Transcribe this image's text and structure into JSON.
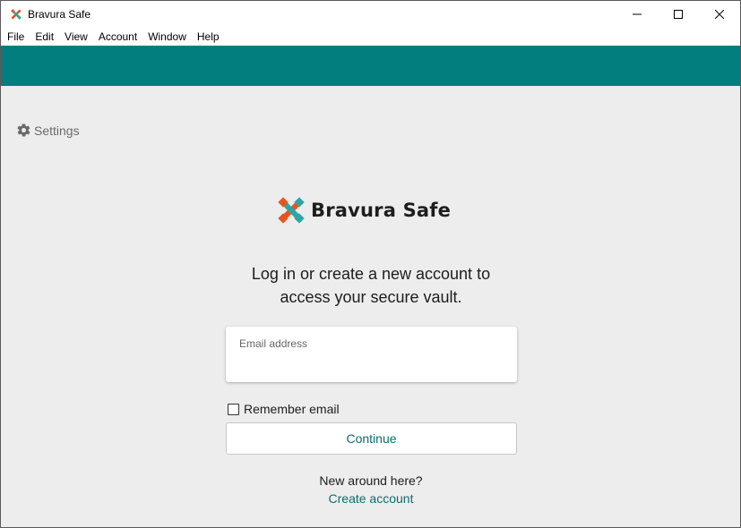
{
  "window": {
    "title": "Bravura Safe",
    "app_icon": "bravura-logo-icon"
  },
  "menubar": {
    "items": [
      "File",
      "Edit",
      "View",
      "Account",
      "Window",
      "Help"
    ]
  },
  "settings": {
    "label": "Settings",
    "icon": "gear-icon"
  },
  "logo": {
    "text": "Bravura Safe",
    "colors": {
      "orange": "#e8541f",
      "teal": "#2ea5a4"
    }
  },
  "login": {
    "tagline_line1": "Log in or create a new account to",
    "tagline_line2": "access your secure vault.",
    "email_label": "Email address",
    "email_value": "",
    "remember_label": "Remember email",
    "remember_checked": false,
    "continue_label": "Continue",
    "new_around": "New around here?",
    "create_account": "Create account"
  },
  "colors": {
    "header_band": "#017e7d",
    "link": "#0c6e6c",
    "background": "#ededed"
  }
}
